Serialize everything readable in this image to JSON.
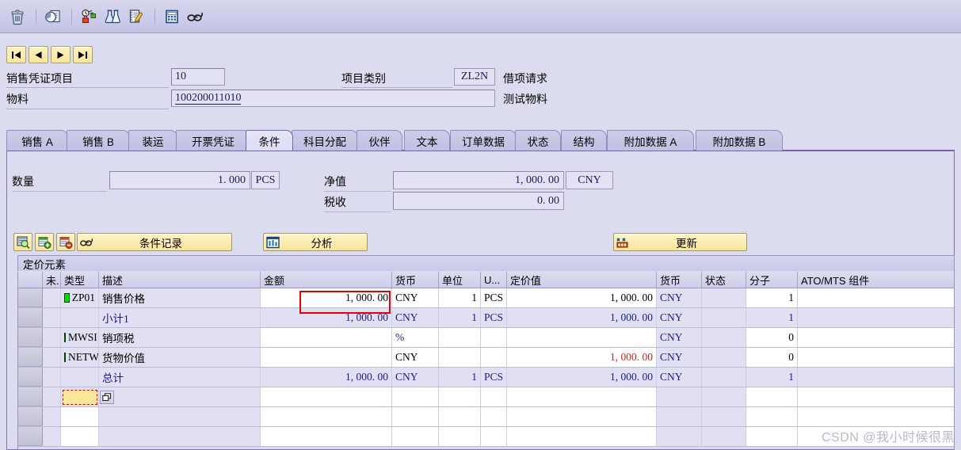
{
  "toolbar": {
    "icons": [
      {
        "name": "delete-icon",
        "title": "删除"
      },
      {
        "name": "document-overview-icon",
        "title": "凭证概览"
      },
      {
        "name": "configuration-lock-icon",
        "title": "配置"
      },
      {
        "name": "flask-icon",
        "title": "测试"
      },
      {
        "name": "notepad-edit-icon",
        "title": "编辑"
      },
      {
        "name": "calculator-icon",
        "title": "计算"
      },
      {
        "name": "glasses-display-icon",
        "title": "显示"
      }
    ]
  },
  "nav": {
    "first": "⏮",
    "prev": "◀",
    "next": "▶",
    "last": "⏭"
  },
  "header": {
    "item_label": "销售凭证项目",
    "item_value": "10",
    "category_label": "项目类别",
    "category_value": "ZL2N",
    "category_text": "借项请求",
    "material_label": "物料",
    "material_value": "100200011010",
    "material_text": "测试物料"
  },
  "tabs": [
    {
      "label": "销售 A",
      "active": false
    },
    {
      "label": "销售 B",
      "active": false
    },
    {
      "label": "装运",
      "active": false
    },
    {
      "label": "开票凭证",
      "active": false
    },
    {
      "label": "条件",
      "active": true
    },
    {
      "label": "科目分配",
      "active": false
    },
    {
      "label": "伙伴",
      "active": false
    },
    {
      "label": "文本",
      "active": false
    },
    {
      "label": "订单数据",
      "active": false
    },
    {
      "label": "状态",
      "active": false
    },
    {
      "label": "结构",
      "active": false
    },
    {
      "label": "附加数据 A",
      "active": false
    },
    {
      "label": "附加数据 B",
      "active": false
    }
  ],
  "summary": {
    "qty_label": "数量",
    "qty_value": "1. 000",
    "qty_unit": "PCS",
    "net_label": "净值",
    "net_value": "1, 000. 00",
    "net_currency": "CNY",
    "tax_label": "税收",
    "tax_value": "0. 00"
  },
  "actions": {
    "condition_record": "条件记录",
    "analysis": "分析",
    "update": "更新"
  },
  "grid": {
    "title": "定价元素",
    "columns": [
      {
        "label": "",
        "key": "sel"
      },
      {
        "label": "未.",
        "key": "inactive"
      },
      {
        "label": "类型",
        "key": "type"
      },
      {
        "label": "描述",
        "key": "description"
      },
      {
        "label": "金额",
        "key": "amount"
      },
      {
        "label": "货币",
        "key": "currency1"
      },
      {
        "label": "单位",
        "key": "per"
      },
      {
        "label": "U...",
        "key": "uom"
      },
      {
        "label": "定价值",
        "key": "condition_value"
      },
      {
        "label": "货币",
        "key": "currency2"
      },
      {
        "label": "状态",
        "key": "status"
      },
      {
        "label": "分子",
        "key": "numerator"
      },
      {
        "label": "ATO/MTS 组件",
        "key": "ato_mts"
      }
    ],
    "rows": [
      {
        "inactive": "",
        "status_box": true,
        "type": "ZP01",
        "description": "销售价格",
        "amount": "1, 000. 00",
        "currency1": "CNY",
        "per": "1",
        "uom": "PCS",
        "condition_value": "1, 000. 00",
        "currency2": "CNY",
        "status": "",
        "numerator": "1",
        "ato_mts": "",
        "style": "normal"
      },
      {
        "inactive": "",
        "status_box": false,
        "type": "",
        "description": "小计1",
        "amount": "1, 000. 00",
        "currency1": "CNY",
        "per": "1",
        "uom": "PCS",
        "condition_value": "1, 000. 00",
        "currency2": "CNY",
        "status": "",
        "numerator": "1",
        "ato_mts": "",
        "style": "subtotal"
      },
      {
        "inactive": "",
        "status_box": true,
        "type": "MWSI",
        "description": "销项税",
        "amount": "",
        "currency1": "%",
        "per": "",
        "uom": "",
        "condition_value": "",
        "currency2": "CNY",
        "status": "",
        "numerator": "0",
        "ato_mts": "",
        "style": "normal"
      },
      {
        "inactive": "",
        "status_box": true,
        "type": "NETW",
        "description": "货物价值",
        "amount": "",
        "currency1": "CNY",
        "per": "",
        "uom": "",
        "condition_value": "1, 000. 00",
        "currency2": "CNY",
        "status": "",
        "numerator": "0",
        "ato_mts": "",
        "style": "netw"
      },
      {
        "inactive": "",
        "status_box": false,
        "type": "",
        "description": "总计",
        "amount": "1, 000. 00",
        "currency1": "CNY",
        "per": "1",
        "uom": "PCS",
        "condition_value": "1, 000. 00",
        "currency2": "CNY",
        "status": "",
        "numerator": "1",
        "ato_mts": "",
        "style": "subtotal"
      },
      {
        "inactive": "",
        "status_box": false,
        "type": "",
        "description": "",
        "amount": "",
        "currency1": "",
        "per": "",
        "uom": "",
        "condition_value": "",
        "currency2": "",
        "status": "",
        "numerator": "",
        "ato_mts": "",
        "style": "input"
      },
      {
        "inactive": "",
        "status_box": false,
        "type": "",
        "description": "",
        "amount": "",
        "currency1": "",
        "per": "",
        "uom": "",
        "condition_value": "",
        "currency2": "",
        "status": "",
        "numerator": "",
        "ato_mts": "",
        "style": "empty"
      },
      {
        "inactive": "",
        "status_box": false,
        "type": "",
        "description": "",
        "amount": "",
        "currency1": "",
        "per": "",
        "uom": "",
        "condition_value": "",
        "currency2": "",
        "status": "",
        "numerator": "",
        "ato_mts": "",
        "style": "empty"
      }
    ]
  },
  "watermark": "CSDN @我小时候很黑",
  "colors": {
    "accent": "#7a5fb0",
    "panel": "#dcdcf0",
    "button": "#f8e49a",
    "status_green": "#00e000",
    "highlight_red": "#e60000",
    "link_blue": "#1a1a8c",
    "value_red": "#cc2222"
  }
}
